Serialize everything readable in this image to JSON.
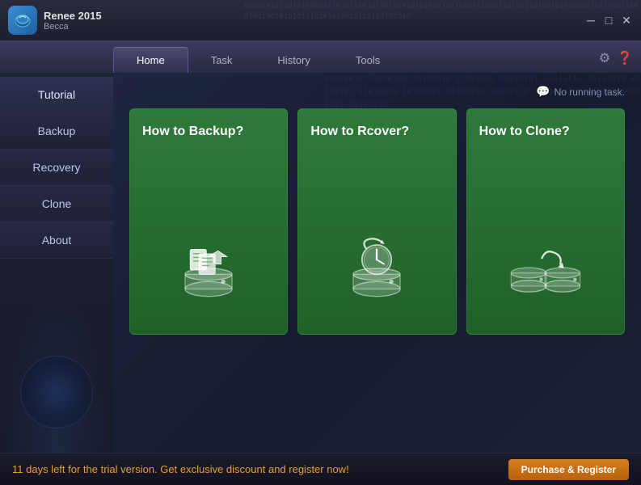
{
  "app": {
    "name": "Renee 2015",
    "subtitle": "Becca",
    "logo_symbol": "🔒"
  },
  "window_controls": {
    "minimize": "─",
    "maximize": "□",
    "close": "✕"
  },
  "tabs": [
    {
      "id": "home",
      "label": "Home",
      "active": true
    },
    {
      "id": "task",
      "label": "Task",
      "active": false
    },
    {
      "id": "history",
      "label": "History",
      "active": false
    },
    {
      "id": "tools",
      "label": "Tools",
      "active": false
    }
  ],
  "sidebar": {
    "items": [
      {
        "id": "tutorial",
        "label": "Tutorial"
      },
      {
        "id": "backup",
        "label": "Backup"
      },
      {
        "id": "recovery",
        "label": "Recovery"
      },
      {
        "id": "clone",
        "label": "Clone"
      },
      {
        "id": "about",
        "label": "About"
      }
    ]
  },
  "status": {
    "text": "No running task.",
    "icon": "💬"
  },
  "cards": [
    {
      "id": "backup",
      "title": "How to Backup?"
    },
    {
      "id": "recover",
      "title": "How to Rcover?"
    },
    {
      "id": "clone",
      "title": "How to Clone?"
    }
  ],
  "notification": {
    "text": "11 days left for the trial version. Get exclusive discount and register now!",
    "button_label": "Purchase & Register"
  }
}
